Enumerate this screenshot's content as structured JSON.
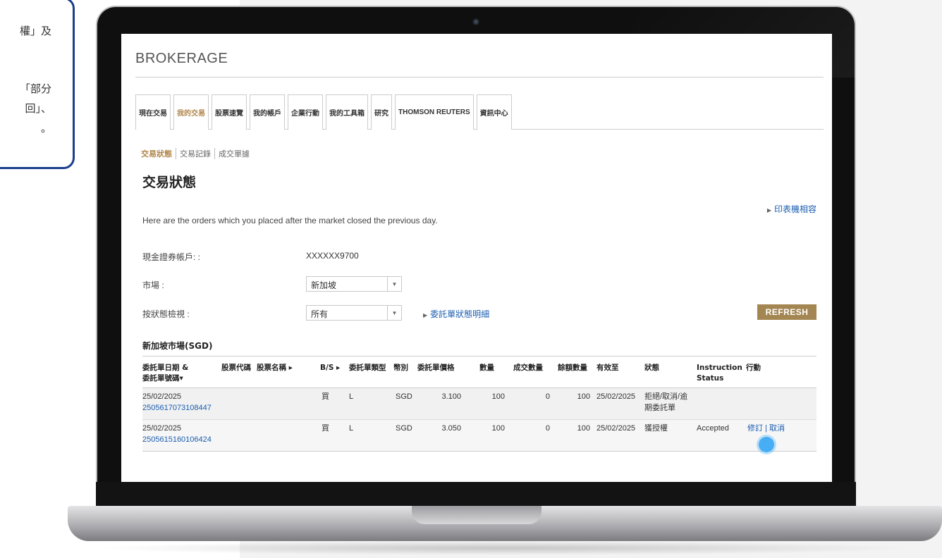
{
  "callout": {
    "line1": "權」及",
    "line2": "「部分",
    "line3": "回」、",
    "line4": "。"
  },
  "app": {
    "brand": "BROKERAGE"
  },
  "tabs": [
    {
      "label": "現在交易"
    },
    {
      "label": "我的交易"
    },
    {
      "label": "股票速覽"
    },
    {
      "label": "我的帳戶"
    },
    {
      "label": "企業行動"
    },
    {
      "label": "我的工具箱"
    },
    {
      "label": "研究"
    },
    {
      "label": "THOMSON REUTERS"
    },
    {
      "label": "資訊中心"
    }
  ],
  "subnav": [
    "交易狀態",
    "交易記錄",
    "成交單據"
  ],
  "page": {
    "title": "交易狀態",
    "print_link": "印表機相容",
    "intro": "Here are the orders which you placed after the market closed the previous day."
  },
  "form": {
    "account_label": "現金證券帳戶: :",
    "account_value": "XXXXXX9700",
    "market_label": "市場 :",
    "market_value": "新加坡",
    "status_label": "按狀態檢視 :",
    "status_value": "所有",
    "status_detail_link": "委託單狀態明細",
    "refresh_label": "REFRESH"
  },
  "table": {
    "section_title": "新加坡市場(SGD)",
    "headers": {
      "date_line1": "委託單日期 &",
      "date_line2": "委託單號碼▾",
      "code": "股票代碼",
      "name": "股票名稱 ▸",
      "bs": "B/S ▸",
      "type": "委託單類型",
      "currency": "幣別",
      "price": "委託單價格",
      "qty": "數量",
      "filled": "成交數量",
      "remaining": "餘額數量",
      "valid": "有效至",
      "status": "狀態",
      "instr_line1": "Instruction",
      "instr_line2": "Status",
      "action": "行動"
    },
    "rows": [
      {
        "date": "25/02/2025",
        "order_no": "2505617073108447",
        "bs": "買",
        "type": "L",
        "currency": "SGD",
        "price": "3.100",
        "qty": "100",
        "filled": "0",
        "remaining": "100",
        "valid": "25/02/2025",
        "status_line1": "拒絕/取消/逾",
        "status_line2": "期委託單",
        "instruction": "",
        "action": ""
      },
      {
        "date": "25/02/2025",
        "order_no": "2505615160106424",
        "bs": "買",
        "type": "L",
        "currency": "SGD",
        "price": "3.050",
        "qty": "100",
        "filled": "0",
        "remaining": "100",
        "valid": "25/02/2025",
        "status_line1": "獲授權",
        "status_line2": "",
        "instruction": "Accepted",
        "action_amend": "修訂",
        "action_sep": "|",
        "action_cancel": "取消"
      }
    ]
  },
  "colors": {
    "accent": "#b0864a",
    "link": "#1a5db0",
    "button": "#a48653",
    "callout_border": "#1a3e8c"
  }
}
